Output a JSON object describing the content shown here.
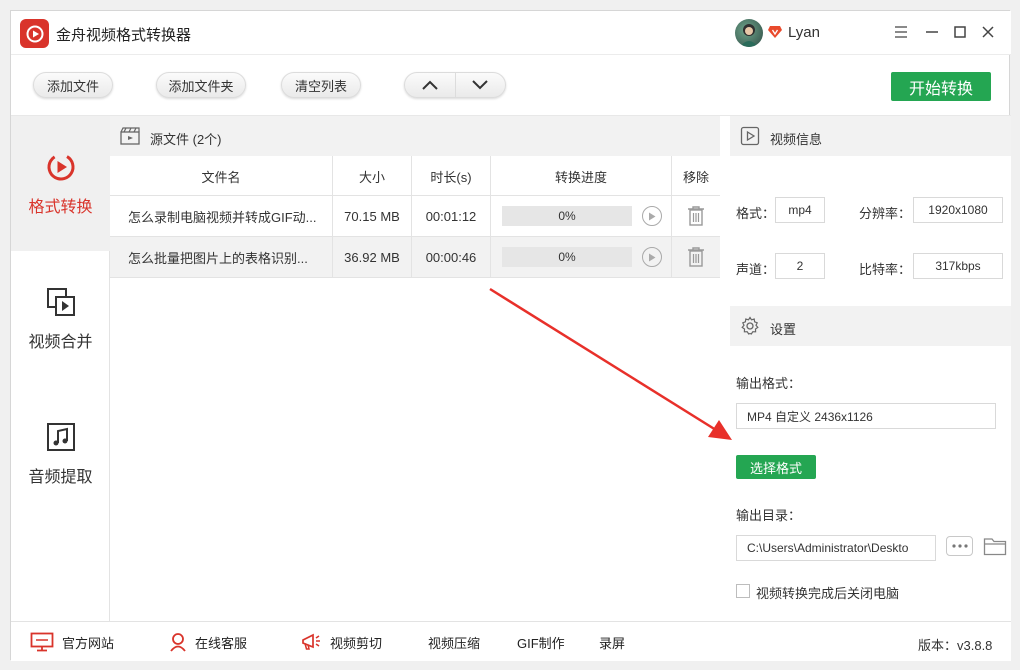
{
  "app": {
    "title": "金舟视频格式转换器",
    "username": "Lyan"
  },
  "window_controls": {
    "menu": "☰",
    "minimize": "—",
    "maximize": "☐",
    "close": "✕"
  },
  "toolbar": {
    "add_file": "添加文件",
    "add_folder": "添加文件夹",
    "clear_list": "清空列表",
    "start": "开始转换"
  },
  "sidebar": {
    "items": [
      {
        "label": "格式转换",
        "icon": "convert-icon",
        "active": true
      },
      {
        "label": "视频合并",
        "icon": "merge-icon",
        "active": false
      },
      {
        "label": "音频提取",
        "icon": "music-icon",
        "active": false
      }
    ]
  },
  "files": {
    "header": "源文件 (2个)",
    "columns": [
      "文件名",
      "大小",
      "时长(s)",
      "转换进度",
      "移除"
    ],
    "rows": [
      {
        "name": "怎么录制电脑视频并转成GIF动...",
        "size": "70.15 MB",
        "duration": "00:01:12",
        "progress": "0%"
      },
      {
        "name": "怎么批量把图片上的表格识别...",
        "size": "36.92 MB",
        "duration": "00:00:46",
        "progress": "0%"
      }
    ]
  },
  "video_info": {
    "title": "视频信息",
    "format_label": "格式：",
    "format": "mp4",
    "resolution_label": "分辨率：",
    "resolution": "1920x1080",
    "channel_label": "声道：",
    "channel": "2",
    "bitrate_label": "比特率：",
    "bitrate": "317kbps"
  },
  "settings": {
    "title": "设置",
    "output_format_label": "输出格式：",
    "output_format": "MP4 自定义 2436x1126",
    "select_format": "选择格式",
    "output_dir_label": "输出目录：",
    "output_dir": "C:\\Users\\Administrator\\Deskto",
    "shutdown_label": "视频转换完成后关闭电脑"
  },
  "footer": {
    "website": "官方网站",
    "support": "在线客服",
    "video_edit": "视频剪切",
    "video_compress": "视频压缩",
    "gif_make": "GIF制作",
    "record": "录屏",
    "version": "版本：v3.8.8"
  },
  "colors": {
    "accent_red": "#d9342b",
    "accent_green": "#24a652",
    "arrow_red": "#e8302a"
  }
}
